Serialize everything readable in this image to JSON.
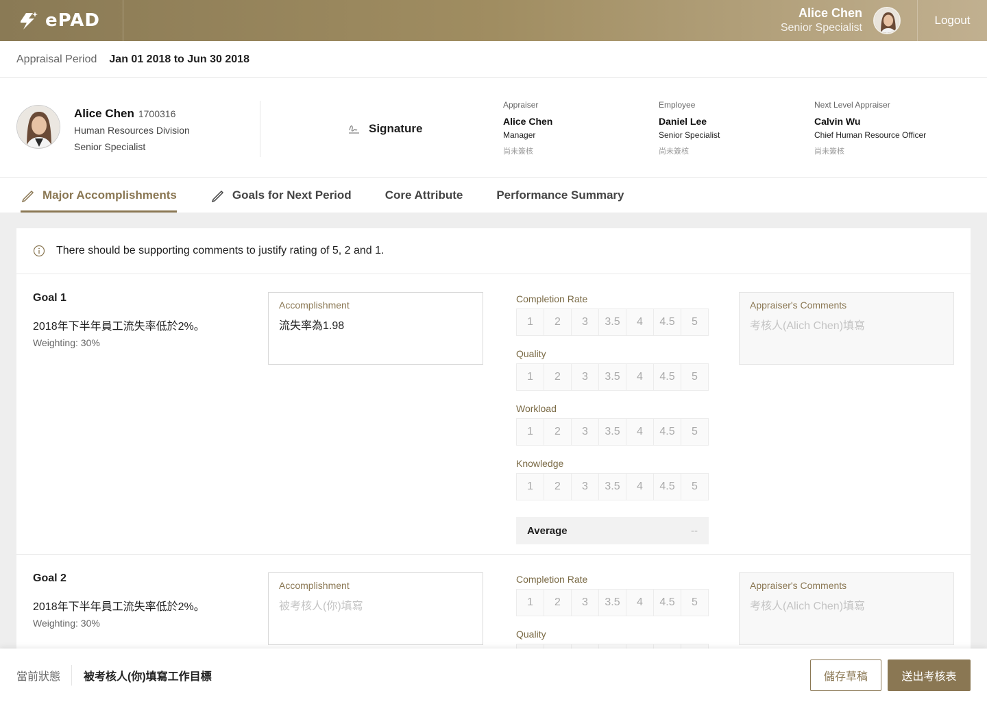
{
  "header": {
    "logo_text": "ePAD",
    "user_name": "Alice Chen",
    "user_role": "Senior Specialist",
    "logout_label": "Logout"
  },
  "period": {
    "label": "Appraisal Period",
    "value": "Jan 01 2018 to Jun 30 2018"
  },
  "profile": {
    "name": "Alice Chen",
    "id": "1700316",
    "division": "Human Resources Division",
    "title": "Senior Specialist",
    "signature_label": "Signature",
    "appraisers": [
      {
        "label": "Appraiser",
        "name": "Alice Chen",
        "title": "Manager",
        "status": "尚未簽核"
      },
      {
        "label": "Employee",
        "name": "Daniel Lee",
        "title": "Senior Specialist",
        "status": "尚未簽核"
      },
      {
        "label": "Next Level Appraiser",
        "name": "Calvin Wu",
        "title": "Chief Human Resource Officer",
        "status": "尚未簽核"
      }
    ]
  },
  "tabs": [
    {
      "label": "Major Accomplishments",
      "active": true
    },
    {
      "label": "Goals for Next Period",
      "active": false
    },
    {
      "label": "Core Attribute",
      "active": false
    },
    {
      "label": "Performance Summary",
      "active": false
    }
  ],
  "notice": "There should be supporting comments to justify rating of 5, 2 and 1.",
  "rating_options": [
    "1",
    "2",
    "3",
    "3.5",
    "4",
    "4.5",
    "5"
  ],
  "goals": [
    {
      "title": "Goal 1",
      "description": "2018年下半年員工流失率低於2%。",
      "weighting": "Weighting: 30%",
      "accomplishment_label": "Accomplishment",
      "accomplishment_value": "流失率為1.98",
      "criteria": [
        "Completion Rate",
        "Quality",
        "Workload",
        "Knowledge"
      ],
      "average_label": "Average",
      "average_value": "--",
      "comments_label": "Appraiser's Comments",
      "comments_placeholder": "考核人(Alich Chen)填寫"
    },
    {
      "title": "Goal 2",
      "description": "2018年下半年員工流失率低於2%。",
      "weighting": "Weighting: 30%",
      "accomplishment_label": "Accomplishment",
      "accomplishment_placeholder": "被考核人(你)填寫",
      "criteria": [
        "Completion Rate",
        "Quality"
      ],
      "comments_label": "Appraiser's Comments",
      "comments_placeholder": "考核人(Alich Chen)填寫"
    }
  ],
  "footer": {
    "status_label": "當前狀態",
    "status_value": "被考核人(你)填寫工作目標",
    "save_label": "儲存草稿",
    "submit_label": "送出考核表"
  },
  "colors": {
    "brand": "#8a7753",
    "header_gradient_start": "#8a7a55",
    "header_gradient_end": "#c1b090"
  }
}
